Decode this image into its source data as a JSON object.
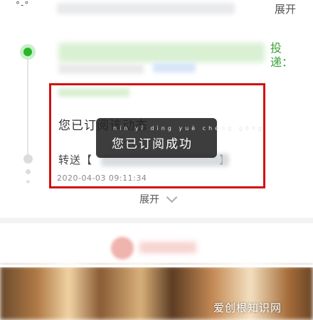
{
  "header": {
    "top_left_glyph": "°-°",
    "top_right_label": "展开"
  },
  "post": {
    "right_label": "投递：",
    "subscription_title": "您已订阅该动态",
    "forward_prefix": "转送【",
    "forward_suffix": "】",
    "timestamp": "2020-04-03 09:11:34",
    "collapse_label": "展开"
  },
  "toast": {
    "pinyin": "nín yǐ dìng yuè chéng gōng",
    "message": "您已订阅成功"
  },
  "watermark": {
    "text": "爱创根知识网"
  },
  "colors": {
    "highlight_border": "#d40f0f",
    "timeline_active": "#2bb52b",
    "toast_bg": "#222222"
  }
}
